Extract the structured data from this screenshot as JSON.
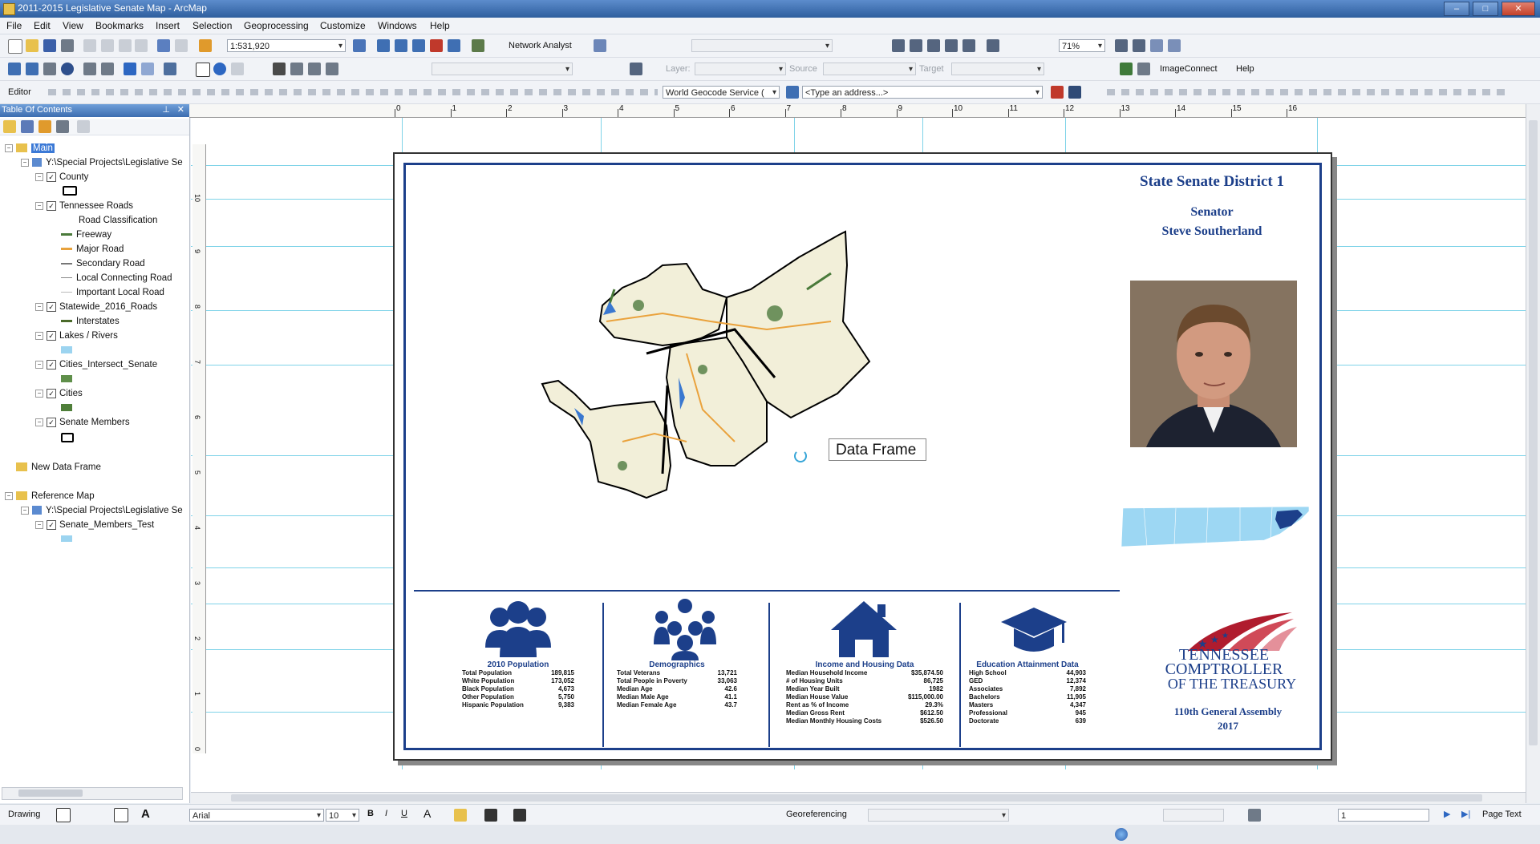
{
  "window": {
    "title": "2011-2015 Legislative Senate Map - ArcMap"
  },
  "menu": [
    "File",
    "Edit",
    "View",
    "Bookmarks",
    "Insert",
    "Selection",
    "Geoprocessing",
    "Customize",
    "Windows",
    "Help"
  ],
  "toolbar": {
    "scale": "1:531,920",
    "network_analyst": "Network Analyst",
    "zoom_percent": "71%",
    "layer_label": "Layer:",
    "source_label": "Source",
    "target_label": "Target",
    "image_connect": "ImageConnect",
    "help": "Help",
    "editor": "Editor",
    "geocode_service": "World Geocode Service (",
    "address_placeholder": "<Type an address...>"
  },
  "toc": {
    "header": "Table Of Contents",
    "items": [
      {
        "label": "Main"
      },
      {
        "label": "Y:\\Special Projects\\Legislative Se"
      },
      {
        "label": "County"
      },
      {
        "label": "Tennessee Roads"
      },
      {
        "label": "Road Classification"
      },
      {
        "label": "Freeway"
      },
      {
        "label": "Major Road"
      },
      {
        "label": "Secondary Road"
      },
      {
        "label": "Local Connecting Road"
      },
      {
        "label": "Important Local Road"
      },
      {
        "label": "Statewide_2016_Roads"
      },
      {
        "label": "Interstates"
      },
      {
        "label": "Lakes / Rivers"
      },
      {
        "label": "Cities_Intersect_Senate"
      },
      {
        "label": "Cities"
      },
      {
        "label": "Senate Members"
      },
      {
        "label": "New Data Frame"
      },
      {
        "label": "Reference Map"
      },
      {
        "label": "Y:\\Special Projects\\Legislative Se"
      },
      {
        "label": "Senate_Members_Test"
      }
    ]
  },
  "ruler": {
    "h_ticks": [
      "0",
      "1",
      "2",
      "3",
      "4",
      "5",
      "6",
      "7",
      "8",
      "9",
      "10",
      "11",
      "12",
      "13",
      "14",
      "15",
      "16"
    ],
    "v_ticks": [
      "10",
      "9",
      "8",
      "7",
      "6",
      "5",
      "4",
      "3",
      "2",
      "1",
      "0"
    ]
  },
  "layout": {
    "title": "State Senate District 1",
    "senator_label": "Senator",
    "senator_name": "Steve Southerland",
    "data_frame_label": "Data Frame",
    "comptroller_line1": "TENNESSEE",
    "comptroller_line2": "COMPTROLLER",
    "comptroller_line3": "OF THE TREASURY",
    "assembly": "110th General Assembly",
    "year": "2017",
    "sections": [
      {
        "title": "2010 Population",
        "rows": [
          [
            "Total Population",
            "189,815"
          ],
          [
            "White Population",
            "173,052"
          ],
          [
            "Black Population",
            "4,673"
          ],
          [
            "Other Population",
            "5,750"
          ],
          [
            "Hispanic Population",
            "9,383"
          ]
        ],
        "icon": "people-icon"
      },
      {
        "title": "Demographics",
        "rows": [
          [
            "Total Veterans",
            "13,721"
          ],
          [
            "Total People in Poverty",
            "33,063"
          ],
          [
            "Median Age",
            "42.6"
          ],
          [
            "Median Male Age",
            "41.1"
          ],
          [
            "Median Female Age",
            "43.7"
          ]
        ],
        "icon": "group-icon"
      },
      {
        "title": "Income and Housing Data",
        "rows": [
          [
            "Median Household Income",
            "$35,874.50"
          ],
          [
            "# of Housing Units",
            "86,725"
          ],
          [
            "Median Year Built",
            "1982"
          ],
          [
            "Median House Value",
            "$115,000.00"
          ],
          [
            "Rent as % of Income",
            "29.3%"
          ],
          [
            "Median Gross Rent",
            "$612.50"
          ],
          [
            "Median Monthly Housing Costs",
            "$526.50"
          ]
        ],
        "icon": "house-icon"
      },
      {
        "title": "Education Attainment Data",
        "rows": [
          [
            "High School",
            "44,903"
          ],
          [
            "GED",
            "12,374"
          ],
          [
            "Associates",
            "7,892"
          ],
          [
            "Bachelors",
            "11,905"
          ],
          [
            "Masters",
            "4,347"
          ],
          [
            "Professional",
            "945"
          ],
          [
            "Doctorate",
            "639"
          ]
        ],
        "icon": "graduation-cap-icon"
      }
    ]
  },
  "drawbar": {
    "drawing": "Drawing",
    "font": "Arial",
    "font_size": "10",
    "georeferencing": "Georeferencing",
    "page_number": "1",
    "page_text": "Page Text"
  },
  "colors": {
    "accent": "#1c3f8a",
    "guide": "#7fd3e8",
    "titlebar": "#2f5f9e"
  }
}
